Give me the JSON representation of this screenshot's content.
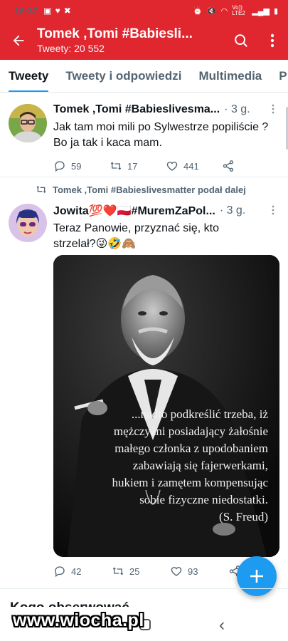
{
  "status_bar": {
    "time": "16:37",
    "network": "Vo)) LTE2"
  },
  "header": {
    "title": "Tomek ,Tomi #Babiesli...",
    "subtitle": "Tweety: 20 552"
  },
  "tabs": [
    {
      "label": "Tweety",
      "active": true
    },
    {
      "label": "Tweety i odpowiedzi",
      "active": false
    },
    {
      "label": "Multimedia",
      "active": false
    },
    {
      "label": "P",
      "active": false
    }
  ],
  "tweets": [
    {
      "author": "Tomek ,Tomi #Babieslivesma...",
      "time": "· 3 g.",
      "text": "Jak tam moi mili po Sylwestrze popiliście ? Bo ja tak i kaca mam.",
      "replies": "59",
      "retweets": "17",
      "likes": "441"
    },
    {
      "retweet_note": "Tomek ,Tomi #Babieslivesmatter podał dalej",
      "author": "Jowita💯❤️🇵🇱#MuremZaPol...",
      "time": "· 3 g.",
      "text": "Teraz Panowie, przyznać się, kto strzelał?😜🤣🙈",
      "image_quote_lines": [
        "...nadto podkreślić trzeba, iż",
        "mężczyźni posiadający żałośnie",
        "małego członka z upodobaniem",
        "zabawiają się fajerwerkami,",
        "hukiem i zamętem kompensując",
        "sobie fizyczne niedostatki.",
        "(S. Freud)"
      ],
      "replies": "42",
      "retweets": "25",
      "likes": "93"
    }
  ],
  "section": {
    "title": "Kogo obserwować"
  },
  "watermark": "www.wiocha.pl",
  "colors": {
    "header_red": "#e0262f",
    "accent_blue": "#1d9bf0",
    "muted": "#536471"
  }
}
